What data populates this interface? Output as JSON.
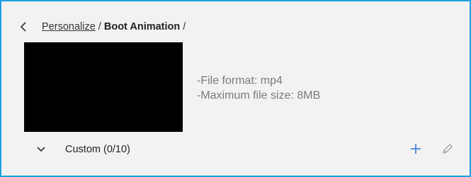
{
  "breadcrumb": {
    "back_icon": "chevron-left-icon",
    "link_label": "Personalize",
    "separator": " / ",
    "current_label": "Boot Animation",
    "trailing_separator": " /"
  },
  "preview": {
    "background": "#000000"
  },
  "info": {
    "format_line": "-File format: mp4",
    "size_line": "-Maximum file size: 8MB"
  },
  "custom": {
    "toggle_icon": "chevron-down-icon",
    "label": "Custom (0/10)",
    "add_icon": "plus-icon",
    "edit_icon": "pencil-icon"
  },
  "colors": {
    "accent_border": "#1ba1e2",
    "panel_background": "#f2f2f2",
    "add_icon_color": "#3a7bd5",
    "muted_text": "#7a7a7a"
  }
}
